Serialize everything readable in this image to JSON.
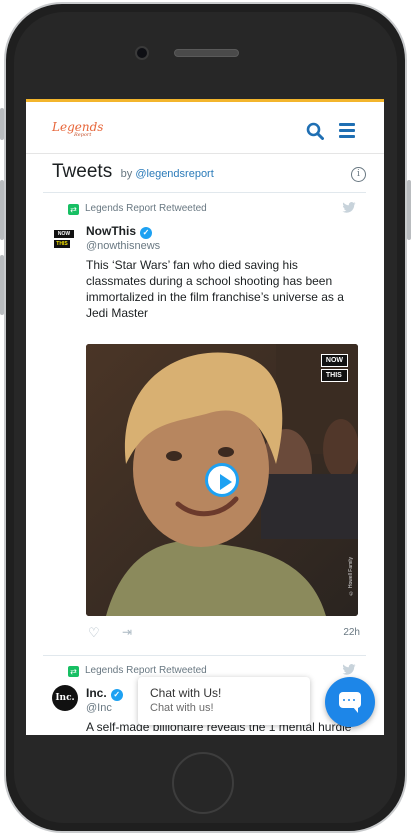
{
  "site": {
    "logo_text": "Legends",
    "logo_sub": "Report"
  },
  "timeline": {
    "title": "Tweets",
    "by": "by",
    "handle": "@legendsreport"
  },
  "tweets": [
    {
      "retweet_label": "Legends Report Retweeted",
      "author": "NowThis",
      "handle": "@nowthisnews",
      "text": "This ‘Star Wars’ fan who died saving his classmates during a school shooting has been immortalized in the film franchise’s universe as a Jedi Master",
      "media_logo_top": "NOW",
      "media_logo_bottom": "THIS",
      "media_credit": "© Howell Family",
      "time": "22h"
    },
    {
      "retweet_label": "Legends Report Retweeted",
      "author": "Inc.",
      "handle": "@Inc",
      "avatar_text": "Inc.",
      "text": "A self-made billionaire reveals the 1 mental hurdle"
    }
  ],
  "chat": {
    "title": "Chat with Us!",
    "subtitle": "Chat with us!"
  },
  "colors": {
    "accent": "#1f6fb3",
    "twitter_blue": "#1da1f2",
    "retweet_green": "#17bf63",
    "topbar_border": "#f3b52c",
    "chat_button": "#1d86e8"
  }
}
